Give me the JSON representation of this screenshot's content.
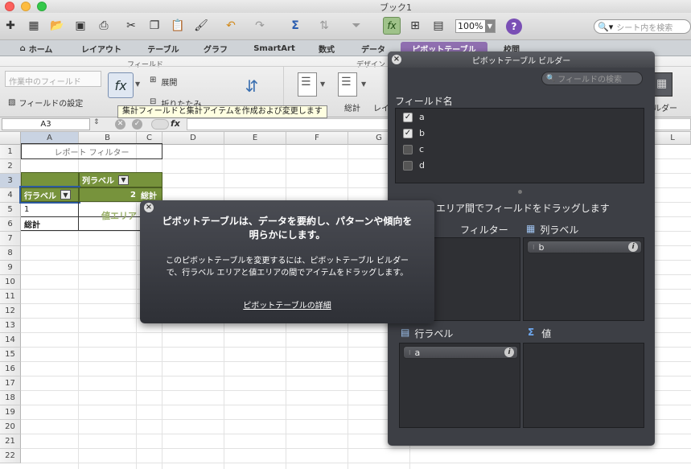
{
  "window": {
    "title": "ブック1"
  },
  "toolbar": {
    "zoom": "100%",
    "search_placeholder": "シート内を検索",
    "help": "?"
  },
  "tabs": [
    {
      "label": "ホーム"
    },
    {
      "label": "レイアウト"
    },
    {
      "label": "テーブル"
    },
    {
      "label": "グラフ"
    },
    {
      "label": "SmartArt"
    },
    {
      "label": "数式"
    },
    {
      "label": "データ"
    },
    {
      "label": "ピボットテーブル"
    },
    {
      "label": "校閲"
    }
  ],
  "ribbon": {
    "group_field": "フィールド",
    "group_design": "デザイン",
    "active_field_placeholder": "作業中のフィールド",
    "field_settings": "フィールドの設定",
    "expand": "展開",
    "collapse": "折りたたみ",
    "totals": "総計",
    "layout": "レイ",
    "builder": "ルダー",
    "tooltip": "集計フィールドと集計アイテムを作成および変更します"
  },
  "formula": {
    "name_box": "A3",
    "fx": "fx"
  },
  "columns": [
    "A",
    "B",
    "C",
    "D",
    "E",
    "F",
    "G",
    "H",
    "L"
  ],
  "rows": [
    "1",
    "2",
    "3",
    "4",
    "5",
    "6",
    "7",
    "8",
    "9",
    "10",
    "11",
    "12",
    "13",
    "14",
    "15",
    "16",
    "17",
    "18",
    "19",
    "20",
    "21",
    "22"
  ],
  "cells": {
    "report_filter": "レポート フィルター",
    "col_label": "列ラベル",
    "row_label": "行ラベル",
    "col_value": "2",
    "grand_total_col": "総計",
    "row_item": "1",
    "grand_total_row": "総計",
    "value_area": "値エリア"
  },
  "builder": {
    "title": "ピボットテーブル ビルダー",
    "search_placeholder": "フィールドの検索",
    "field_name_label": "フィールド名",
    "fields": [
      {
        "name": "a",
        "checked": true
      },
      {
        "name": "b",
        "checked": true
      },
      {
        "name": "c",
        "checked": false
      },
      {
        "name": "d",
        "checked": false
      }
    ],
    "drag_hint": "エリア間でフィールドをドラッグします",
    "filter_label": "フィルター",
    "col_label": "列ラベル",
    "row_label": "行ラベル",
    "values_label": "値",
    "col_item": "b",
    "row_item": "a",
    "info": "i"
  },
  "popover": {
    "heading_line1": "ピボットテーブルは、データを要約し、パターンや傾向を",
    "heading_line2": "明らかにします。",
    "body_line1": "このピボットテーブルを変更するには、ピボットテーブル ビルダー",
    "body_line2": "で、行ラベル エリアと値エリアの間でアイテムをドラッグします。",
    "link": "ピボットテーブルの詳細"
  },
  "colors": {
    "pivot_green": "#77933c",
    "pane_bg": "#3d3f45",
    "active_tab": "#8f6fb0"
  }
}
